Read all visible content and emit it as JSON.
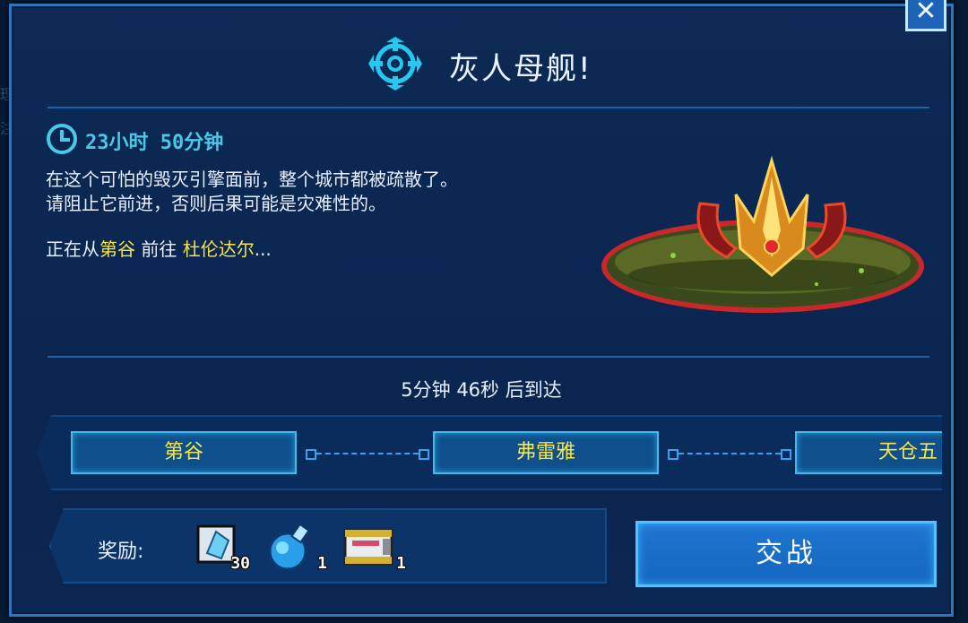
{
  "background_peek": {
    "left": "理",
    "left2": "注"
  },
  "dialog": {
    "title": "灰人母舰!",
    "close_label": "✕",
    "timer": "23小时 50分钟",
    "description_line1": "在这个可怕的毁灭引擎面前，整个城市都被疏散了。",
    "description_line2": "请阻止它前进，否则后果可能是灾难性的。",
    "route": {
      "prefix": "正在从",
      "from": "第谷",
      "middle": " 前往 ",
      "to": "杜伦达尔",
      "suffix": "..."
    },
    "arrival": "5分钟 46秒 后到达",
    "path_nodes": [
      {
        "label": "第谷"
      },
      {
        "label": "弗雷雅"
      },
      {
        "label": "天仓五"
      }
    ],
    "rewards_label": "奖励:",
    "rewards": [
      {
        "icon": "crystal-icon",
        "qty": "30"
      },
      {
        "icon": "potion-flask-icon",
        "qty": "1"
      },
      {
        "icon": "supply-crate-icon",
        "qty": "1"
      }
    ],
    "fight_label": "交战"
  },
  "colors": {
    "accent": "#2a77c0",
    "highlight_text": "#f5e64a",
    "timer_text": "#49c9e8",
    "panel_bg": "#0a2550"
  }
}
